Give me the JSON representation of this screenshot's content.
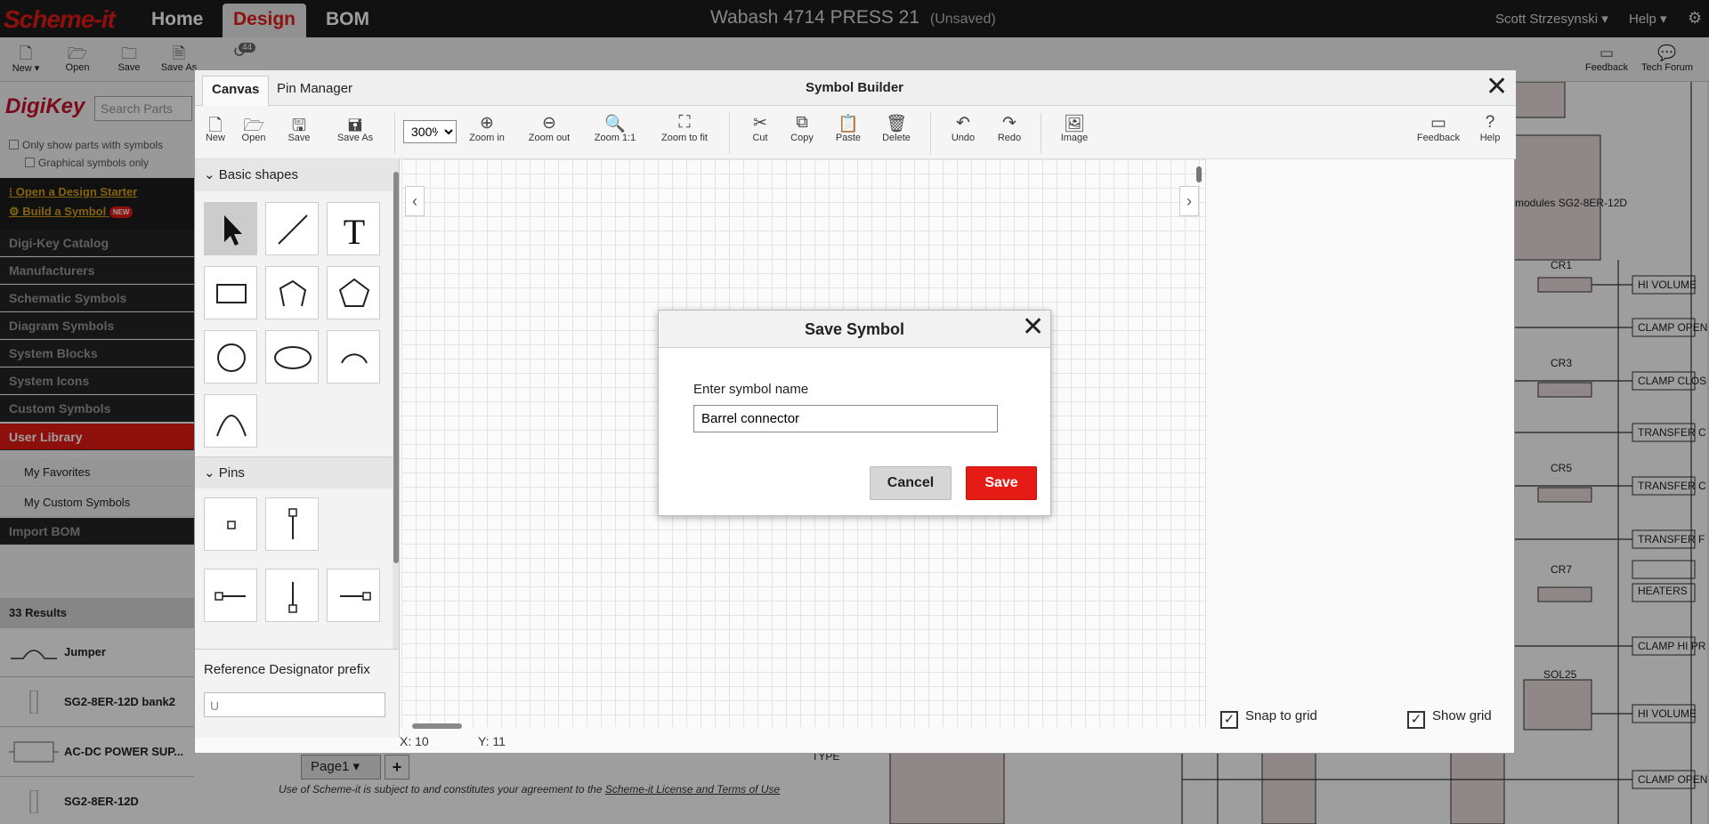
{
  "app": {
    "logo": "Scheme-it",
    "nav": [
      "Home",
      "Design",
      "BOM"
    ],
    "doc_title": "Wabash 4714 PRESS 21",
    "doc_status": "(Unsaved)",
    "user": "Scott Strzesynski ▾",
    "help": "Help ▾",
    "history_badge": "44"
  },
  "main_toolbar": {
    "left": [
      {
        "icon": "file-icon",
        "label": "New ▾"
      },
      {
        "icon": "folder-icon",
        "label": "Open"
      },
      {
        "icon": "save-icon",
        "label": "Save"
      },
      {
        "icon": "save-as-icon",
        "label": "Save As"
      }
    ],
    "right": [
      {
        "icon": "feedback-icon",
        "label": "Feedback"
      },
      {
        "icon": "forum-icon",
        "label": "Tech Forum"
      }
    ]
  },
  "left_panel": {
    "brand": "DigiKey",
    "search_placeholder": "Search Parts",
    "only_symbols": "Only show parts with symbols",
    "graphical_only": "Graphical symbols only",
    "open_starter": "Open a Design Starter",
    "build_symbol": "Build a Symbol",
    "new_badge": "NEW",
    "categories": [
      "Digi-Key Catalog",
      "Manufacturers",
      "Schematic Symbols",
      "Diagram Symbols",
      "System Blocks",
      "System Icons",
      "Custom Symbols",
      "User Library"
    ],
    "sub_items": [
      "My Favorites",
      "My Custom Symbols"
    ],
    "import_bom": "Import BOM",
    "results_count": "33 Results",
    "results": [
      "Jumper",
      "SG2-8ER-12D bank2",
      "AC-DC POWER SUP...",
      "SG2-8ER-12D"
    ]
  },
  "schematic": {
    "labels": [
      "modules SG2-8ER-12D",
      "CR1",
      "HI VOLUME",
      "CLAMP OPEN",
      "CR3",
      "CLAMP CLOS",
      "TRANSFER C",
      "CR5",
      "TRANSFER C",
      "TRANSFER F",
      "CR7",
      "HEATERS",
      "CLAMP HI PR",
      "SOL25",
      "HI VOLUME",
      "CLAMP OPEN",
      "TYPE"
    ],
    "page_tab": "Page1 ▾",
    "page_add": "+",
    "license_text": "Use of Scheme-it is subject to and constitutes your agreement to the",
    "license_link": "Scheme-it License and Terms of Use"
  },
  "symbol_builder": {
    "title": "Symbol Builder",
    "tabs": [
      "Canvas",
      "Pin Manager"
    ],
    "zoom": "300%",
    "toolbar": [
      {
        "icon": "file-icon",
        "label": "New"
      },
      {
        "icon": "folder-icon",
        "label": "Open"
      },
      {
        "icon": "save-icon",
        "label": "Save"
      },
      {
        "icon": "save-as-icon",
        "label": "Save As"
      },
      {
        "icon": "zoom-in-icon",
        "label": "Zoom in"
      },
      {
        "icon": "zoom-out-icon",
        "label": "Zoom out"
      },
      {
        "icon": "zoom-actual-icon",
        "label": "Zoom 1:1"
      },
      {
        "icon": "zoom-fit-icon",
        "label": "Zoom to fit"
      },
      {
        "icon": "cut-icon",
        "label": "Cut"
      },
      {
        "icon": "copy-icon",
        "label": "Copy"
      },
      {
        "icon": "paste-icon",
        "label": "Paste"
      },
      {
        "icon": "delete-icon",
        "label": "Delete"
      },
      {
        "icon": "undo-icon",
        "label": "Undo"
      },
      {
        "icon": "redo-icon",
        "label": "Redo"
      },
      {
        "icon": "image-icon",
        "label": "Image"
      },
      {
        "icon": "feedback-icon",
        "label": "Feedback"
      },
      {
        "icon": "help-icon",
        "label": "Help"
      }
    ],
    "basic_shapes": "Basic shapes",
    "pins": "Pins",
    "ref_designator_label": "Reference Designator prefix",
    "ref_designator_placeholder": "U",
    "coord_x": "X: 10",
    "coord_y": "Y: 11",
    "snap_to_grid": "Snap to grid",
    "show_grid": "Show grid"
  },
  "save_dialog": {
    "title": "Save Symbol",
    "label": "Enter symbol name",
    "value": "Barrel connector",
    "cancel": "Cancel",
    "save": "Save"
  }
}
